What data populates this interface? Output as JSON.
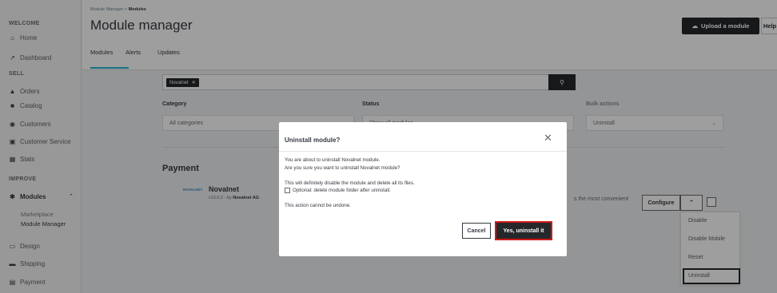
{
  "sidebar": {
    "sections": {
      "welcome": "WELCOME",
      "sell": "SELL",
      "improve": "IMPROVE"
    },
    "items": [
      {
        "label": "Home",
        "icon": "home-icon"
      },
      {
        "label": "Dashboard",
        "icon": "trending-icon"
      },
      {
        "label": "Orders",
        "icon": "cart-icon"
      },
      {
        "label": "Catalog",
        "icon": "store-icon"
      },
      {
        "label": "Customers",
        "icon": "user-circle-icon"
      },
      {
        "label": "Customer Service",
        "icon": "chat-icon"
      },
      {
        "label": "Stats",
        "icon": "chart-icon"
      },
      {
        "label": "Modules",
        "icon": "puzzle-icon"
      },
      {
        "label": "Design",
        "icon": "monitor-icon"
      },
      {
        "label": "Shipping",
        "icon": "truck-icon"
      },
      {
        "label": "Payment",
        "icon": "card-icon"
      }
    ],
    "modules_sub": [
      "Marketplace",
      "Module Manager"
    ]
  },
  "header": {
    "breadcrumb_parent": "Module Manager",
    "breadcrumb_sep": ">",
    "breadcrumb_current": "Modules",
    "title": "Module manager",
    "upload_label": "Upload a module",
    "help_label": "Help",
    "tabs": [
      "Modules",
      "Alerts",
      "Updates"
    ]
  },
  "filters": {
    "search_tag": "Novalnet",
    "category_label": "Category",
    "category_value": "All categories",
    "status_label": "Status",
    "status_value": "Show all modules",
    "bulk_label": "Bulk actions",
    "bulk_value": "Uninstall"
  },
  "module": {
    "section": "Payment",
    "logo_text": "NOVALNET",
    "name": "Novalnet",
    "version": "v13.0.2 - by",
    "author": "Novalnet AG",
    "desc_fragment": "s the most convenient",
    "configure_label": "Configure",
    "dropdown": [
      "Disable",
      "Disable Mobile",
      "Reset",
      "Uninstall"
    ]
  },
  "modal": {
    "title": "Uninstall module?",
    "line1": "You are about to uninstall Novalnet module.",
    "line2": "Are you sure you want to uninstall Novalnet module?",
    "line3": "This will definitely disable the module and delete all its files.",
    "optional_label": "Optional: delete module folder after uninstall.",
    "line4": "This action cannot be undone.",
    "cancel_label": "Cancel",
    "confirm_label": "Yes, uninstall it"
  }
}
